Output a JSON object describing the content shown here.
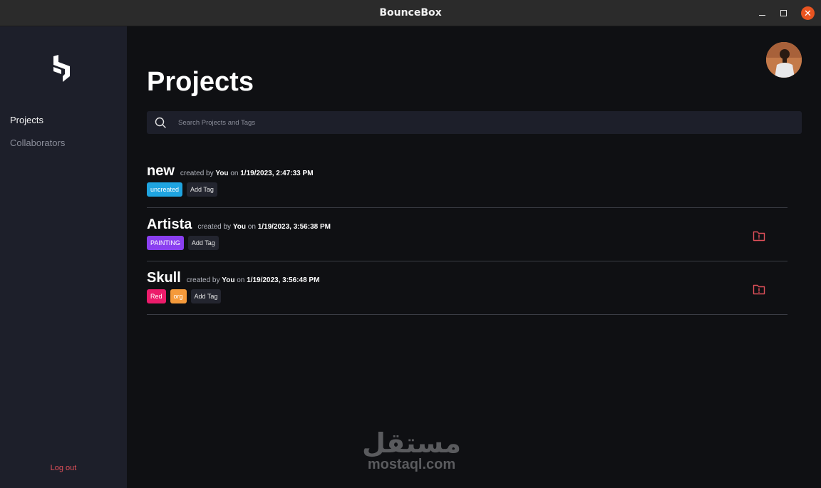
{
  "window": {
    "title": "BounceBox"
  },
  "sidebar": {
    "items": [
      {
        "label": "Projects",
        "active": true
      },
      {
        "label": "Collaborators",
        "active": false
      }
    ],
    "logout": "Log out"
  },
  "main": {
    "title": "Projects",
    "search": {
      "placeholder": "Search Projects and Tags",
      "value": ""
    },
    "add_tag_label": "Add Tag",
    "projects": [
      {
        "name": "new",
        "created_by_prefix": "created by",
        "user": "You",
        "on": "on",
        "date": "1/19/2023, 2:47:33 PM",
        "tags": [
          {
            "label": "uncreated",
            "color": "#1fa4e0"
          }
        ],
        "warning_icon": false
      },
      {
        "name": "Artista",
        "created_by_prefix": "created by",
        "user": "You",
        "on": "on",
        "date": "1/19/2023, 3:56:38 PM",
        "tags": [
          {
            "label": "PAINTING",
            "color": "#8a3ff0"
          }
        ],
        "warning_icon": true
      },
      {
        "name": "Skull",
        "created_by_prefix": "created by",
        "user": "You",
        "on": "on",
        "date": "1/19/2023, 3:56:48 PM",
        "tags": [
          {
            "label": "Red",
            "color": "#ec1c6b"
          },
          {
            "label": "org",
            "color": "#f59a3b"
          }
        ],
        "warning_icon": true
      }
    ]
  },
  "watermark": {
    "arabic": "مستقل",
    "latin": "mostaql.com"
  },
  "colors": {
    "accent_close": "#e95420",
    "warning_icon": "#e0505a",
    "sidebar_bg": "#1d1f2a",
    "main_bg": "#0f1013"
  }
}
